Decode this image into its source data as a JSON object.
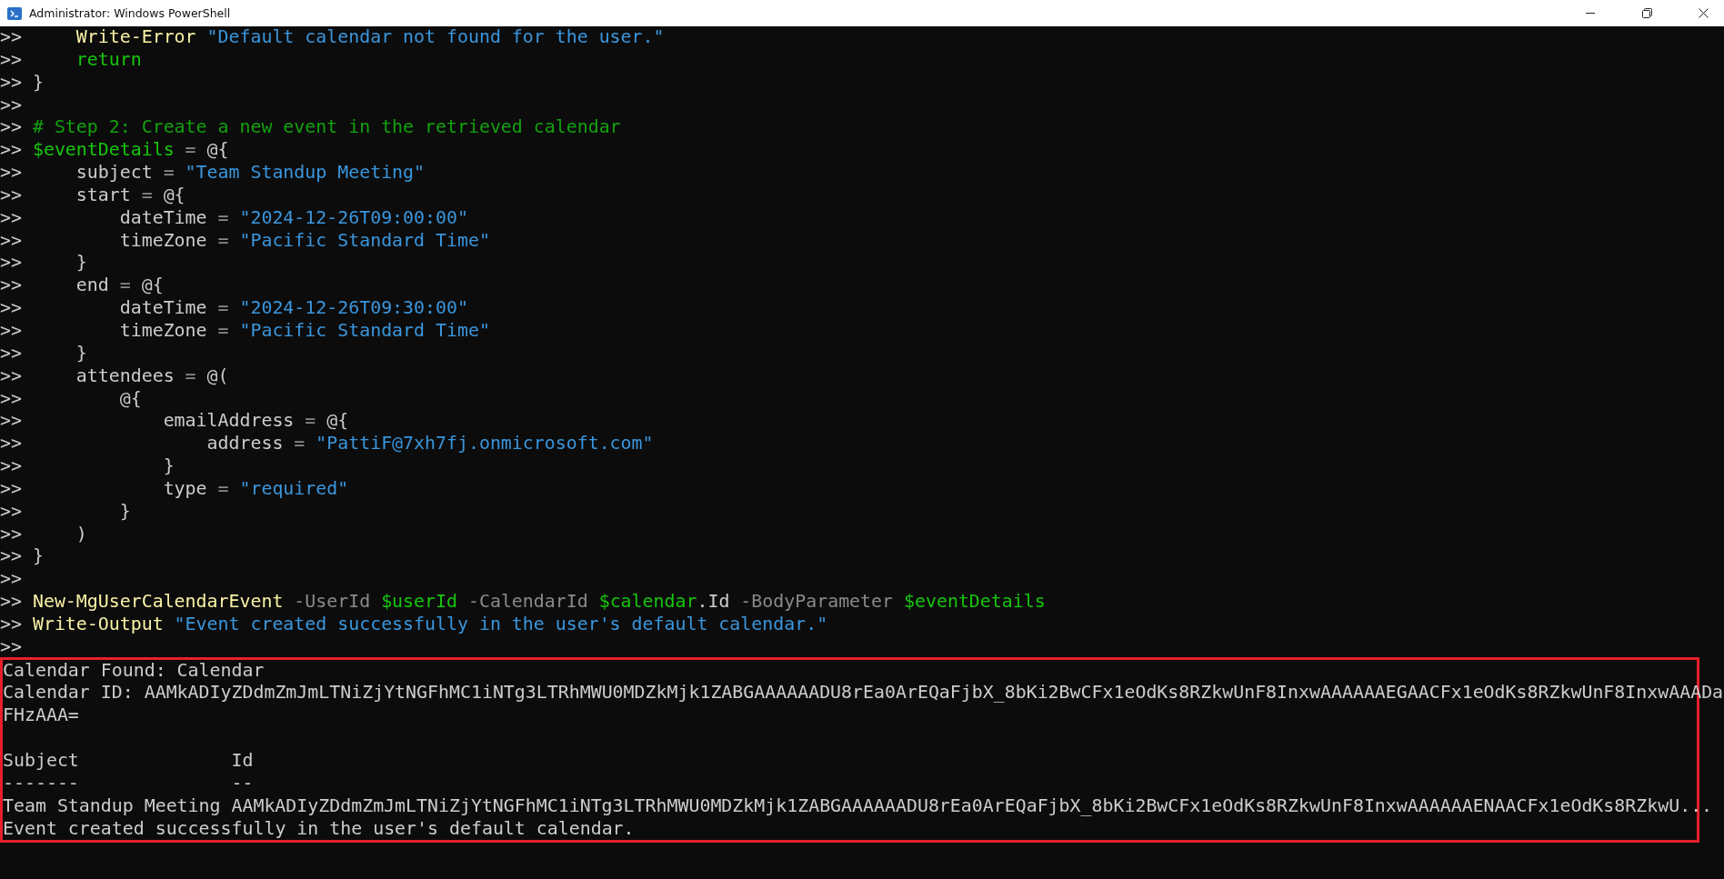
{
  "window": {
    "title": "Administrator: Windows PowerShell"
  },
  "console": {
    "lines": [
      {
        "prompt": ">>",
        "tokens": [
          {
            "kind": "cmdlet",
            "text": "     Write-Error"
          },
          {
            "kind": "string",
            "text": " \"Default calendar not found for the user.\""
          }
        ]
      },
      {
        "prompt": ">>",
        "tokens": [
          {
            "kind": "keyword",
            "text": "     return"
          }
        ]
      },
      {
        "prompt": ">>",
        "tokens": [
          {
            "kind": "plain",
            "text": " }"
          }
        ]
      },
      {
        "prompt": ">>"
      },
      {
        "prompt": ">>",
        "tokens": [
          {
            "kind": "comment",
            "text": " # Step 2: Create a new event in the retrieved calendar"
          }
        ]
      },
      {
        "prompt": ">>",
        "tokens": [
          {
            "kind": "variable",
            "text": " $eventDetails"
          },
          {
            "kind": "operator",
            "text": " ="
          },
          {
            "kind": "plain",
            "text": " @{"
          }
        ]
      },
      {
        "prompt": ">>",
        "tokens": [
          {
            "kind": "plain",
            "text": "     subject"
          },
          {
            "kind": "operator",
            "text": " ="
          },
          {
            "kind": "string",
            "text": " \"Team Standup Meeting\""
          }
        ]
      },
      {
        "prompt": ">>",
        "tokens": [
          {
            "kind": "plain",
            "text": "     start"
          },
          {
            "kind": "operator",
            "text": " ="
          },
          {
            "kind": "plain",
            "text": " @{"
          }
        ]
      },
      {
        "prompt": ">>",
        "tokens": [
          {
            "kind": "plain",
            "text": "         dateTime"
          },
          {
            "kind": "operator",
            "text": " ="
          },
          {
            "kind": "string",
            "text": " \"2024-12-26T09:00:00\""
          }
        ]
      },
      {
        "prompt": ">>",
        "tokens": [
          {
            "kind": "plain",
            "text": "         timeZone"
          },
          {
            "kind": "operator",
            "text": " ="
          },
          {
            "kind": "string",
            "text": " \"Pacific Standard Time\""
          }
        ]
      },
      {
        "prompt": ">>",
        "tokens": [
          {
            "kind": "plain",
            "text": "     }"
          }
        ]
      },
      {
        "prompt": ">>",
        "tokens": [
          {
            "kind": "plain",
            "text": "     end"
          },
          {
            "kind": "operator",
            "text": " ="
          },
          {
            "kind": "plain",
            "text": " @{"
          }
        ]
      },
      {
        "prompt": ">>",
        "tokens": [
          {
            "kind": "plain",
            "text": "         dateTime"
          },
          {
            "kind": "operator",
            "text": " ="
          },
          {
            "kind": "string",
            "text": " \"2024-12-26T09:30:00\""
          }
        ]
      },
      {
        "prompt": ">>",
        "tokens": [
          {
            "kind": "plain",
            "text": "         timeZone"
          },
          {
            "kind": "operator",
            "text": " ="
          },
          {
            "kind": "string",
            "text": " \"Pacific Standard Time\""
          }
        ]
      },
      {
        "prompt": ">>",
        "tokens": [
          {
            "kind": "plain",
            "text": "     }"
          }
        ]
      },
      {
        "prompt": ">>",
        "tokens": [
          {
            "kind": "plain",
            "text": "     attendees"
          },
          {
            "kind": "operator",
            "text": " ="
          },
          {
            "kind": "plain",
            "text": " @("
          }
        ]
      },
      {
        "prompt": ">>",
        "tokens": [
          {
            "kind": "plain",
            "text": "         @{"
          }
        ]
      },
      {
        "prompt": ">>",
        "tokens": [
          {
            "kind": "plain",
            "text": "             emailAddress"
          },
          {
            "kind": "operator",
            "text": " ="
          },
          {
            "kind": "plain",
            "text": " @{"
          }
        ]
      },
      {
        "prompt": ">>",
        "tokens": [
          {
            "kind": "plain",
            "text": "                 address"
          },
          {
            "kind": "operator",
            "text": " ="
          },
          {
            "kind": "string",
            "text": " \"PattiF@7xh7fj.onmicrosoft.com\""
          }
        ]
      },
      {
        "prompt": ">>",
        "tokens": [
          {
            "kind": "plain",
            "text": "             }"
          }
        ]
      },
      {
        "prompt": ">>",
        "tokens": [
          {
            "kind": "plain",
            "text": "             type"
          },
          {
            "kind": "operator",
            "text": " ="
          },
          {
            "kind": "string",
            "text": " \"required\""
          }
        ]
      },
      {
        "prompt": ">>",
        "tokens": [
          {
            "kind": "plain",
            "text": "         }"
          }
        ]
      },
      {
        "prompt": ">>",
        "tokens": [
          {
            "kind": "plain",
            "text": "     )"
          }
        ]
      },
      {
        "prompt": ">>",
        "tokens": [
          {
            "kind": "plain",
            "text": " }"
          }
        ]
      },
      {
        "prompt": ">>"
      },
      {
        "prompt": ">>",
        "tokens": [
          {
            "kind": "cmdlet",
            "text": " New-MgUserCalendarEvent"
          },
          {
            "kind": "parameter",
            "text": " -UserId"
          },
          {
            "kind": "variable",
            "text": " $userId"
          },
          {
            "kind": "parameter",
            "text": " -CalendarId"
          },
          {
            "kind": "variable",
            "text": " $calendar"
          },
          {
            "kind": "plain",
            "text": ".Id"
          },
          {
            "kind": "parameter",
            "text": " -BodyParameter"
          },
          {
            "kind": "variable",
            "text": " $eventDetails"
          }
        ]
      },
      {
        "prompt": ">>",
        "tokens": [
          {
            "kind": "cmdlet",
            "text": " Write-Output"
          },
          {
            "kind": "string",
            "text": " \"Event created successfully in the user's default calendar.\""
          }
        ]
      },
      {
        "prompt": ">>"
      }
    ],
    "output": {
      "calendar_info": [
        "Calendar Found: Calendar",
        "Calendar ID: AAMkADIyZDdmZmJmLTNiZjYtNGFhMC1iNTg3LTRhMWU0MDZkMjk1ZABGAAAAAADU8rEa0ArEQaFjbX_8bKi2BwCFx1eOdKs8RZkwUnF8InxwAAAAAAEGAACFx1eOdKs8RZkwUnF8InxwAAADa",
        "FHzAAA="
      ],
      "table": {
        "columns": [
          "Subject",
          "Id"
        ],
        "separators": [
          "-------",
          "--"
        ],
        "rows": [
          [
            "Team Standup Meeting",
            "AAMkADIyZDdmZmJmLTNiZjYtNGFhMC1iNTg3LTRhMWU0MDZkMjk1ZABGAAAAAADU8rEa0ArEQaFjbX_8bKi2BwCFx1eOdKs8RZkwUnF8InxwAAAAAAENAACFx1eOdKs8RZkwU..."
          ]
        ]
      },
      "message": "Event created successfully in the user's default calendar."
    }
  }
}
